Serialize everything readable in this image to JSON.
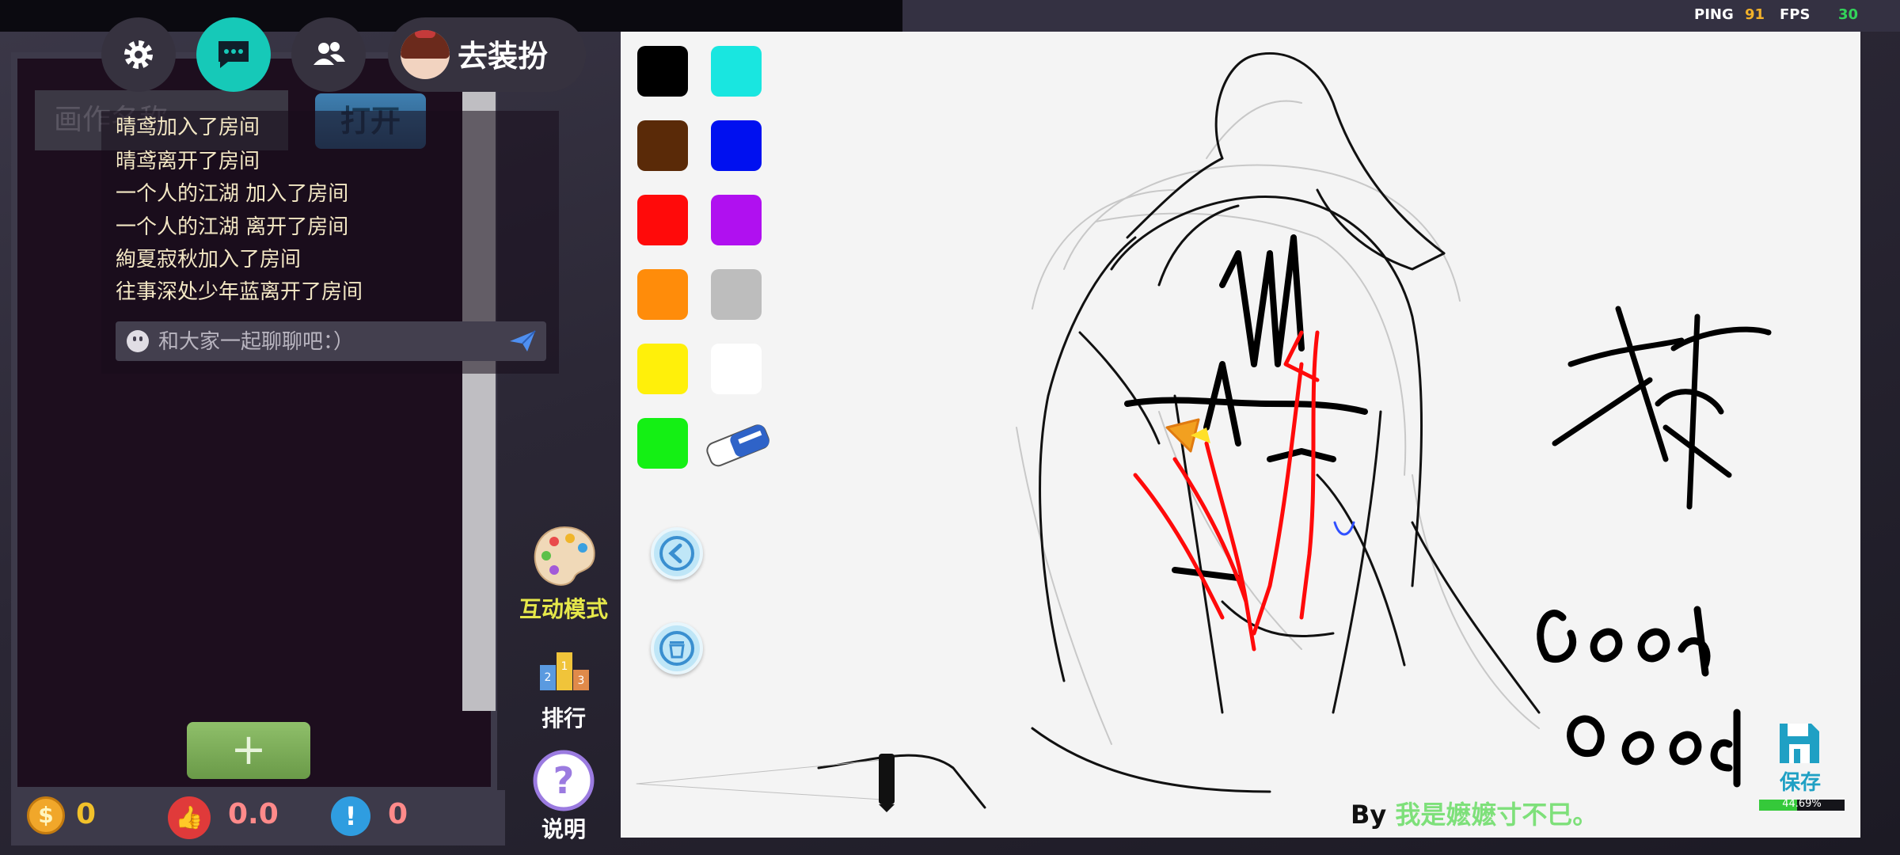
{
  "hud": {
    "ping_label": "PING",
    "ping_value": "91",
    "fps_label": "FPS",
    "fps_value": "30"
  },
  "top_bar": {
    "dress_up_label": "去装扮"
  },
  "room": {
    "name_placeholder": "画作名称",
    "open_button": "打开",
    "add_button": "+"
  },
  "chat": {
    "messages": [
      "晴鸢加入了房间",
      "晴鸢离开了房间",
      "一个人的江湖 加入了房间",
      "一个人的江湖 离开了房间",
      "絢夏寂秋加入了房间",
      "往事深处少年蓝离开了房间"
    ],
    "input_placeholder": "和大家一起聊聊吧：）"
  },
  "stats": {
    "coins": "0",
    "likes": "0.0",
    "reports": "0"
  },
  "side_menu": {
    "interactive_mode": "互动模式",
    "ranking": "排行",
    "help": "说明"
  },
  "palette": {
    "colors": [
      "#000000",
      "#19e6e0",
      "#5a2a08",
      "#0010f0",
      "#ff0a0a",
      "#b010f0",
      "#ff8c0a",
      "#bdbdbd",
      "#fff00a",
      "#ffffff",
      "#14f014"
    ]
  },
  "canvas": {
    "by_prefix": "By",
    "author": "我是嬷嬷寸不巳。",
    "save_label": "保存",
    "progress_text": "44.69%",
    "progress_value": 0.4469
  },
  "colors": {
    "accent": "#16c9b8",
    "author": "#7ee07a",
    "side_label_yellow": "#e6e84a"
  }
}
